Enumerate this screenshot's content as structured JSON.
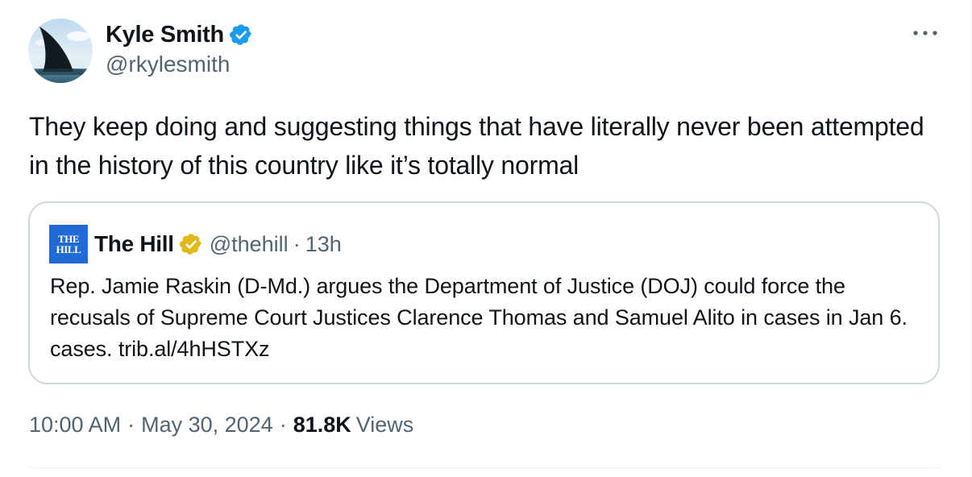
{
  "author": {
    "display_name": "Kyle Smith",
    "handle": "@rkylesmith",
    "verified_color": "#1d9bf0"
  },
  "tweet": {
    "text": "They keep doing and suggesting things that have literally never been attempted in the history of this country like it’s totally normal"
  },
  "quoted": {
    "logo_text_top": "THE",
    "logo_text_bottom": "HILL",
    "display_name": "The Hill",
    "handle": "@thehill",
    "separator": "·",
    "time": "13h",
    "verified_color": "#e2b719",
    "text": "Rep. Jamie Raskin (D-Md.) argues the Department of Justice (DOJ) could force the recusals of Supreme Court Justices Clarence Thomas and Samuel Alito in cases in Jan 6. cases. trib.al/4hHSTXz"
  },
  "meta": {
    "time": "10:00 AM",
    "date": "May 30, 2024",
    "separator": "·",
    "views_count": "81.8K",
    "views_label": "Views"
  },
  "icons": {
    "avatar": "shark-fin-avatar",
    "verified": "verified-badge-icon",
    "more": "more-horizontal-icon"
  }
}
